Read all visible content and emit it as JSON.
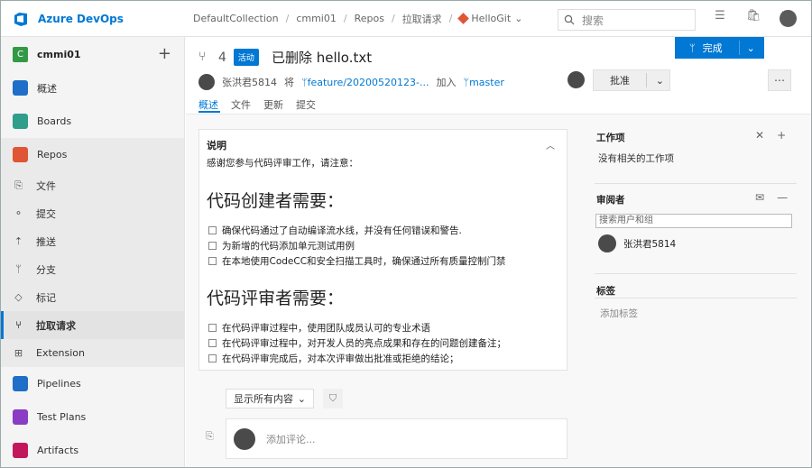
{
  "app": {
    "name": "Azure DevOps"
  },
  "breadcrumbs": [
    "DefaultCollection",
    "cmmi01",
    "Repos",
    "拉取请求",
    "HelloGit"
  ],
  "search": {
    "placeholder": "搜索"
  },
  "sidebar": {
    "project": {
      "badge": "C",
      "name": "cmmi01"
    },
    "items": [
      {
        "label": "概述",
        "icon": "overview-icon",
        "color": "#1f6ec7"
      },
      {
        "label": "Boards",
        "icon": "boards-icon",
        "color": "#2f9e8a"
      },
      {
        "label": "Repos",
        "icon": "repos-icon",
        "color": "#e05534"
      },
      {
        "label": "文件",
        "icon": "file-icon"
      },
      {
        "label": "提交",
        "icon": "commit-icon"
      },
      {
        "label": "推送",
        "icon": "push-icon"
      },
      {
        "label": "分支",
        "icon": "branch-icon"
      },
      {
        "label": "标记",
        "icon": "tag-icon"
      },
      {
        "label": "拉取请求",
        "icon": "pullrequest-icon"
      },
      {
        "label": "Extension",
        "icon": "grid-icon"
      },
      {
        "label": "Pipelines",
        "icon": "pipelines-icon",
        "color": "#1f6ec7"
      },
      {
        "label": "Test Plans",
        "icon": "testplans-icon",
        "color": "#8a3cc4"
      },
      {
        "label": "Artifacts",
        "icon": "artifacts-icon",
        "color": "#c2185b"
      }
    ]
  },
  "pr": {
    "number": "4",
    "status": "活动",
    "title": "已删除 hello.txt",
    "author": "张洪君5814",
    "from_prefix": "将",
    "source_branch": "feature/20200520123-...",
    "into_prefix": "加入",
    "target_branch": "master",
    "tabs": [
      "概述",
      "文件",
      "更新",
      "提交"
    ],
    "approve_label": "批准",
    "complete_label": "完成"
  },
  "description": {
    "title": "说明",
    "intro": "感谢您参与代码评审工作，请注意：",
    "section1": "代码创建者需要：",
    "items1": [
      "确保代码通过了自动编译流水线，并没有任何错误和警告.",
      "为新增的代码添加单元测试用例",
      "在本地使用CodeCC和安全扫描工具时，确保通过所有质量控制门禁"
    ],
    "section2": "代码评审者需要：",
    "items2": [
      "在代码评审过程中，使用团队成员认可的专业术语",
      "在代码评审过程中，对开发人员的亮点成果和存在的问题创建备注；",
      "在代码评审完成后，对本次评审做出批准或拒绝的结论；"
    ]
  },
  "discussion": {
    "filter": "显示所有内容",
    "comment_placeholder": "添加评论..."
  },
  "right": {
    "work_items": {
      "title": "工作项",
      "empty": "没有相关的工作项"
    },
    "reviewers": {
      "title": "审阅者",
      "placeholder": "搜索用户和组",
      "name": "张洪君5814"
    },
    "tags": {
      "title": "标签",
      "add": "添加标签"
    }
  }
}
